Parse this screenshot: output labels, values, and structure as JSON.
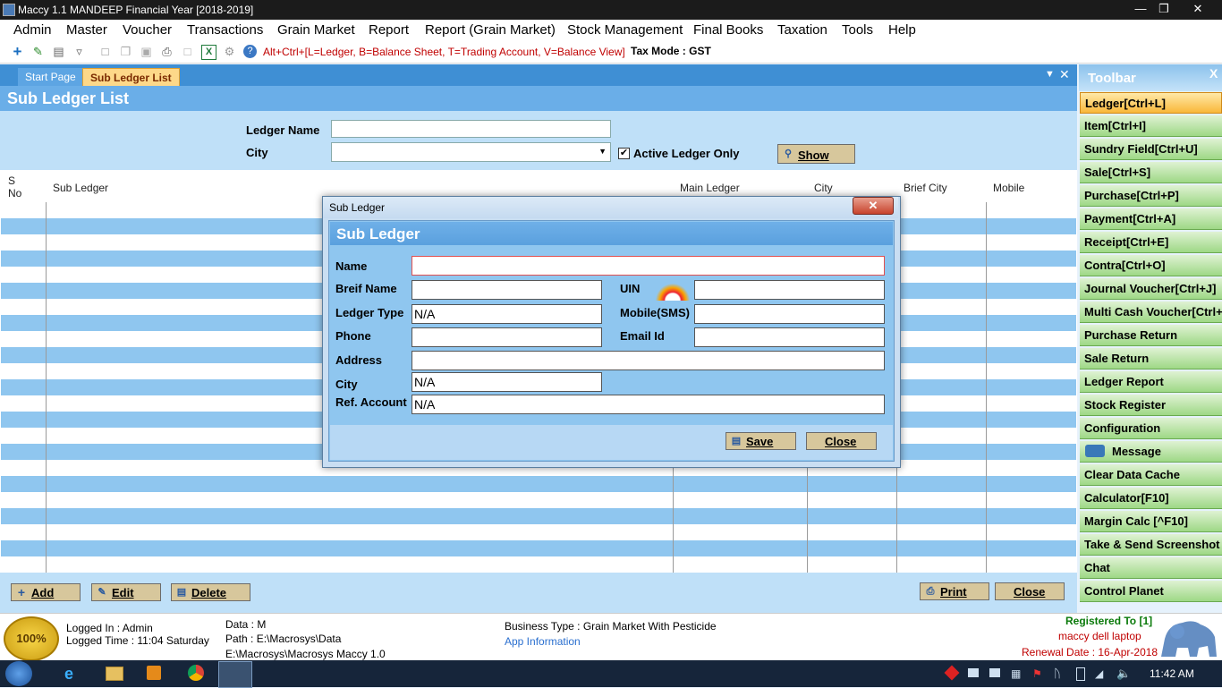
{
  "window": {
    "title": "Maccy 1.1 MANDEEP Financial Year [2018-2019]"
  },
  "menu": [
    "Admin",
    "Master",
    "Voucher",
    "Transactions",
    "Grain Market",
    "Report",
    "Report (Grain Market)",
    "Stock Management",
    "Final Books",
    "Taxation",
    "Tools",
    "Help"
  ],
  "toolbar": {
    "hint": "Alt+Ctrl+[L=Ledger, B=Balance Sheet, T=Trading Account, V=Balance View]",
    "tax_mode": "Tax Mode : GST"
  },
  "tabs": {
    "start": "Start Page",
    "active": "Sub Ledger List"
  },
  "page": {
    "title": "Sub Ledger List"
  },
  "filter": {
    "ledger_name_label": "Ledger Name",
    "ledger_name_value": "",
    "city_label": "City",
    "city_value": "",
    "active_only_label": "Active Ledger Only",
    "active_only_checked": true,
    "show_label": "Show"
  },
  "grid": {
    "columns": {
      "sno": "S\nNo",
      "sub_ledger": "Sub Ledger",
      "main_ledger": "Main Ledger",
      "city": "City",
      "brief_city": "Brief City",
      "mobile": "Mobile"
    }
  },
  "bottom_buttons": {
    "add": "Add",
    "edit": "Edit",
    "delete": "Delete",
    "print": "Print",
    "close": "Close"
  },
  "right_toolbar": {
    "title": "Toolbar",
    "items": [
      "Ledger[Ctrl+L]",
      "Item[Ctrl+I]",
      "Sundry Field[Ctrl+U]",
      "Sale[Ctrl+S]",
      "Purchase[Ctrl+P]",
      "Payment[Ctrl+A]",
      "Receipt[Ctrl+E]",
      "Contra[Ctrl+O]",
      "Journal Voucher[Ctrl+J]",
      "Multi Cash Voucher[Ctrl+",
      "Purchase Return",
      "Sale Return",
      "Ledger Report",
      "Stock Register",
      "Configuration",
      "Message",
      "Clear Data Cache",
      "Calculator[F10]",
      "Margin Calc [^F10]",
      "Take & Send Screenshot",
      "Chat",
      "Control Planet"
    ]
  },
  "dialog": {
    "window_title": "Sub Ledger",
    "header": "Sub Ledger",
    "labels": {
      "name": "Name",
      "brief_name": "Breif Name",
      "uin": "UIN",
      "ledger_type": "Ledger Type",
      "mobile": "Mobile(SMS)",
      "phone": "Phone",
      "email": "Email Id",
      "address": "Address",
      "city": "City",
      "ref_account": "Ref. Account"
    },
    "values": {
      "name": "",
      "brief_name": "",
      "uin": "",
      "ledger_type": "N/A",
      "mobile": "",
      "phone": "",
      "email": "",
      "address": "",
      "city": "N/A",
      "ref_account": "N/A"
    },
    "save": "Save",
    "close": "Close"
  },
  "status": {
    "badge_text": "100%",
    "logged_in": "Logged In : Admin",
    "logged_time": "Logged Time : 11:04 Saturday",
    "data": "Data : M",
    "path": "Path : E:\\Macrosys\\Data",
    "exe_path": "E:\\Macrosys\\Macrosys Maccy 1.0",
    "business_type": "Business Type : Grain Market With Pesticide",
    "app_info": "App Information",
    "registered": "Registered To [1]",
    "registered_name": "maccy dell laptop",
    "renewal": "Renewal Date : 16-Apr-2018"
  },
  "taskbar": {
    "clock": "11:42 AM"
  },
  "colors": {
    "accent_blue": "#6aaee8",
    "row_blue": "#8fc6ef",
    "hint_red": "#c00000",
    "active_tab": "#fdd889",
    "toolbar_green": "#9ed886"
  }
}
